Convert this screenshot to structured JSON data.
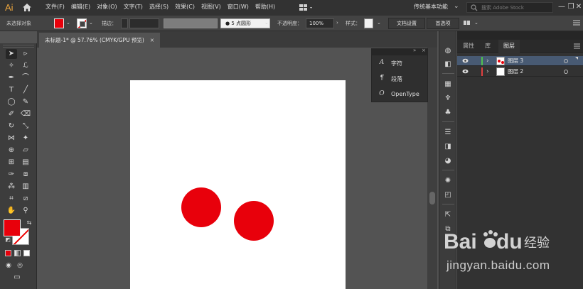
{
  "app": {
    "logo": "Ai"
  },
  "menu": [
    "文件(F)",
    "编辑(E)",
    "对象(O)",
    "文字(T)",
    "选择(S)",
    "效果(C)",
    "视图(V)",
    "窗口(W)",
    "帮助(H)"
  ],
  "workspace": {
    "label": "传统基本功能"
  },
  "search": {
    "placeholder": "搜索 Adobe Stock"
  },
  "window_controls": {
    "minimize": "—",
    "restore": "❐",
    "close": "✕"
  },
  "control_bar": {
    "selection_label": "未选择对象",
    "fill_color": "#e8000b",
    "stroke_label": "描边：",
    "brush": "●  5 点圆形",
    "opacity_label": "不透明度：",
    "opacity_value": "100%",
    "style_label": "样式：",
    "doc_setup_button": "文档设置",
    "preferences_button": "首选项"
  },
  "document": {
    "tab_title": "未标题-1* @ 57.76% (CMYK/GPU 预览)",
    "close": "×",
    "artboard_color": "#ffffff",
    "circle_color": "#e8000b"
  },
  "char_panel": {
    "items": [
      {
        "icon": "A",
        "label": "字符"
      },
      {
        "icon": "¶",
        "label": "段落"
      },
      {
        "icon": "O",
        "label": "OpenType"
      }
    ]
  },
  "layers_panel": {
    "tabs": [
      "属性",
      "库",
      "图层"
    ],
    "layers": [
      {
        "name": "图层 3",
        "color": "#4fc24f",
        "selected": true
      },
      {
        "name": "图层 2",
        "color": "#e04040",
        "selected": false
      }
    ]
  },
  "watermark": {
    "text": "jingyan.baidu.com"
  }
}
